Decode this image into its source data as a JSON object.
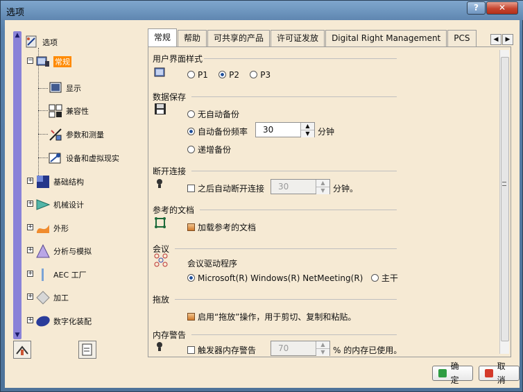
{
  "window": {
    "title": "选项",
    "help_label": "?"
  },
  "tree": {
    "root": "选项",
    "items": [
      {
        "label": "常规"
      },
      {
        "label": "显示"
      },
      {
        "label": "兼容性"
      },
      {
        "label": "参数和测量"
      },
      {
        "label": "设备和虚拟现实"
      },
      {
        "label": "基础结构"
      },
      {
        "label": "机械设计"
      },
      {
        "label": "外形"
      },
      {
        "label": "分析与模拟"
      },
      {
        "label": "AEC 工厂"
      },
      {
        "label": "加工"
      },
      {
        "label": "数字化装配"
      }
    ]
  },
  "tabs": [
    {
      "label": "常规"
    },
    {
      "label": "帮助"
    },
    {
      "label": "可共享的产品"
    },
    {
      "label": "许可证发放"
    },
    {
      "label": "Digital Right Management"
    },
    {
      "label": "PCS"
    }
  ],
  "sections": {
    "ui_style": {
      "title": "用户界面样式",
      "options": [
        "P1",
        "P2",
        "P3"
      ],
      "selected": "P2"
    },
    "data_save": {
      "title": "数据保存",
      "no_auto": "无自动备份",
      "auto_freq": "自动备份频率",
      "value": "30",
      "unit": "分钟",
      "incremental": "递增备份"
    },
    "disconnect": {
      "title": "断开连接",
      "label": "之后自动断开连接",
      "value": "30",
      "unit": "分钟。"
    },
    "ref_docs": {
      "title": "参考的文档",
      "label": "加载参考的文档"
    },
    "meeting": {
      "title": "会议",
      "driver_label": "会议驱动程序",
      "opt1": "Microsoft(R) Windows(R) NetMeeting(R)",
      "opt2": "主干"
    },
    "drag": {
      "title": "拖放",
      "label": "启用“拖放”操作，用于剪切、复制和粘贴。"
    },
    "mem": {
      "title": "内存警告",
      "label": "触发器内存警告",
      "value": "70",
      "unit": "% 的内存已使用。"
    }
  },
  "buttons": {
    "ok": "确定",
    "cancel": "取消"
  }
}
